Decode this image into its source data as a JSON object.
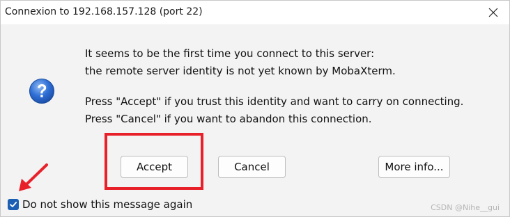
{
  "window": {
    "title": "Connexion to 192.168.157.128 (port 22)",
    "close_icon": "close-icon"
  },
  "dialog": {
    "icon": "question-icon",
    "message_lines": [
      "It seems to be the first time you connect to this server:",
      "the remote server identity is not yet known by MobaXterm.",
      "Press \"Accept\" if you trust this identity and want to carry on connecting.",
      "Press \"Cancel\" if you want to abandon this connection."
    ]
  },
  "buttons": {
    "accept_label": "Accept",
    "cancel_label": "Cancel",
    "more_info_label": "More info..."
  },
  "checkbox": {
    "label": "Do not show this message again",
    "checked": true
  },
  "annotations": {
    "highlight_color": "#e8202a",
    "arrow_icon": "red-arrow-icon"
  },
  "watermark": "CSDN @Nihe__gui",
  "colors": {
    "checkbox_accent": "#1a5fb4",
    "icon_blue": "#2f6fd6"
  }
}
